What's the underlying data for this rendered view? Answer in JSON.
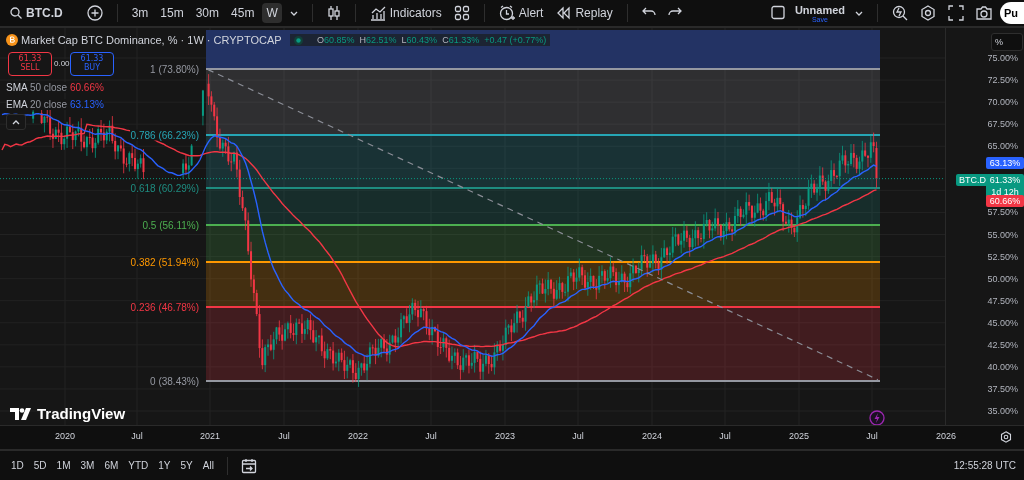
{
  "toolbar": {
    "symbol": "BTC.D",
    "intervals": [
      {
        "label": "3m",
        "selected": false
      },
      {
        "label": "15m",
        "selected": false
      },
      {
        "label": "30m",
        "selected": false
      },
      {
        "label": "45m",
        "selected": false
      },
      {
        "label": "W",
        "selected": true
      }
    ],
    "indicators": "Indicators",
    "alert": "Alert",
    "replay": "Replay",
    "layout_name": "Unnamed",
    "save": "Save",
    "avatar": "Pu"
  },
  "legend": {
    "title": "Market Cap BTC Dominance, % · 1W · CRYPTOCAP",
    "ohlc": [
      {
        "label": "O",
        "value": "60.85%"
      },
      {
        "label": "H",
        "value": "62.51%"
      },
      {
        "label": "L",
        "value": "60.43%"
      },
      {
        "label": "C",
        "value": "61.33%"
      }
    ],
    "change": "+0.47 (+0.77%)",
    "sell": {
      "price": "61.33",
      "label": "SELL"
    },
    "spread": "0.00",
    "buy": {
      "price": "61.33",
      "label": "BUY"
    },
    "studies": [
      {
        "name": "SMA",
        "params": "50 close",
        "value": "60.66%",
        "color": "#f23645"
      },
      {
        "name": "EMA",
        "params": "20 close",
        "value": "63.13%",
        "color": "#2962ff"
      }
    ]
  },
  "fib_levels": [
    {
      "label": "1 (73.80%)",
      "color": "#9598a1"
    },
    {
      "label": "0.786 (66.23%)",
      "color": "#26a6b5"
    },
    {
      "label": "0.618 (60.29%)",
      "color": "#1e8c80"
    },
    {
      "label": "0.5 (56.11%)",
      "color": "#4caf50"
    },
    {
      "label": "0.382 (51.94%)",
      "color": "#ff9800"
    },
    {
      "label": "0.236 (46.78%)",
      "color": "#f23645"
    },
    {
      "label": "0 (38.43%)",
      "color": "#9598a1"
    }
  ],
  "price_axis": {
    "unit": "%",
    "ticks": [
      "75.00%",
      "72.50%",
      "70.00%",
      "67.50%",
      "65.00%",
      "57.50%",
      "55.00%",
      "52.50%",
      "50.00%",
      "47.50%",
      "45.00%",
      "42.50%",
      "40.00%",
      "37.50%",
      "35.00%"
    ],
    "symbol_tag": "BTC.D",
    "markers": [
      {
        "text": "63.13%",
        "color": "#2962ff"
      },
      {
        "text": "61.33%",
        "countdown": "1d 12h",
        "color": "#089981"
      },
      {
        "text": "60.66%",
        "color": "#f23645"
      }
    ]
  },
  "logo": "TradingView",
  "time_axis": [
    "2020",
    "Jul",
    "2021",
    "Jul",
    "2022",
    "Jul",
    "2023",
    "Jul",
    "2024",
    "Jul",
    "2025",
    "Jul",
    "2026"
  ],
  "ranges": [
    "1D",
    "5D",
    "1M",
    "3M",
    "6M",
    "YTD",
    "1Y",
    "5Y",
    "All"
  ],
  "clock": "12:55:28 UTC"
}
